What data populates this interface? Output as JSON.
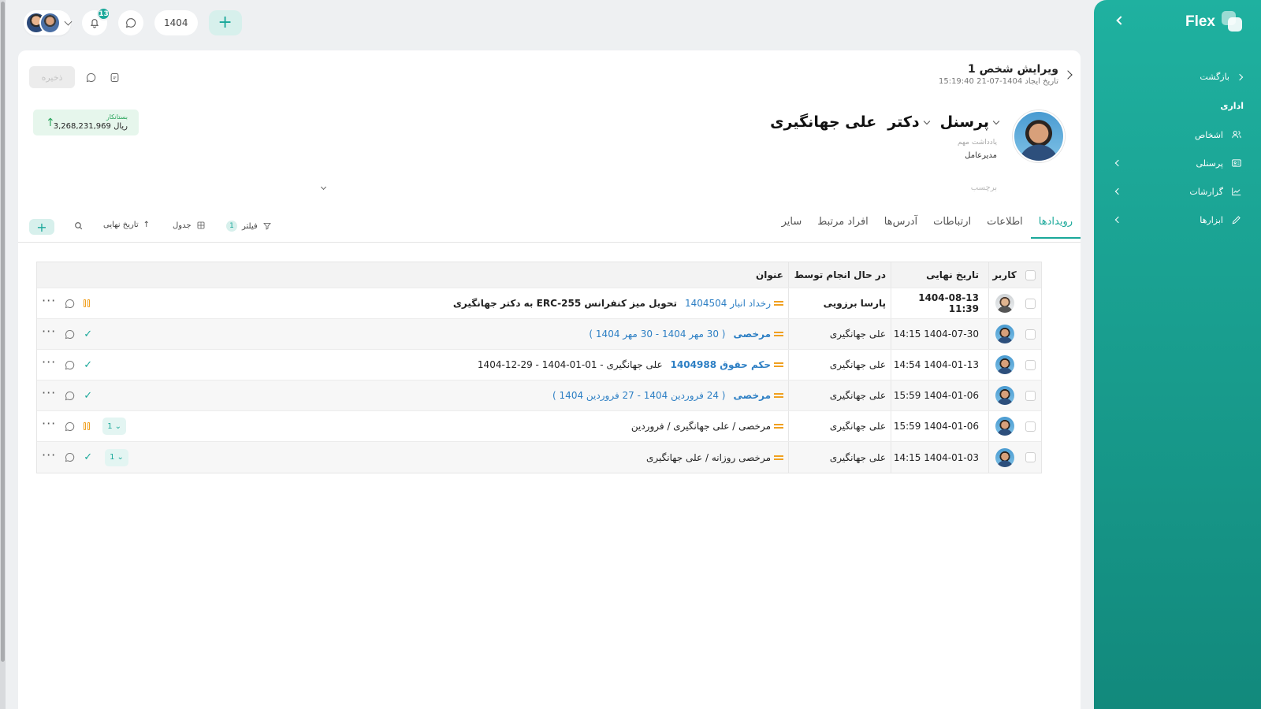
{
  "topbar": {
    "notif_count": "13",
    "year": "1404",
    "add_label": "+"
  },
  "header": {
    "title": "ویرایش شخص 1",
    "created": "تاریخ ایجاد 1404-07-21 15:19:40",
    "save_label": "ذخیره"
  },
  "profile": {
    "name": "علی جهانگیری",
    "title": "دکتر",
    "group": "پرسنل",
    "note_label": "یادداشت مهم",
    "role": "مدیرعامل",
    "tag_label": "برچسب"
  },
  "balance": {
    "label": "بستانکار",
    "value": "3,268,231,969 ریال"
  },
  "tabs": [
    {
      "label": "رویدادها",
      "active": true
    },
    {
      "label": "اطلاعات"
    },
    {
      "label": "ارتباطات"
    },
    {
      "label": "آدرس‌ها"
    },
    {
      "label": "افراد مرتبط"
    },
    {
      "label": "سایر"
    }
  ],
  "tools": {
    "filter_label": "فیلتر",
    "filter_count": "1",
    "view_label": "جدول",
    "sort_label": "تاریخ نهایی"
  },
  "table": {
    "headers": {
      "user": "کاربر",
      "date": "تاریخ نهایی",
      "by": "در حال انجام توسط",
      "title": "عنوان"
    },
    "rows": [
      {
        "date": "1404-08-13 11:39",
        "by": "پارسا برزویی",
        "prefix": "",
        "link": "رخداد انبار 1404504",
        "text": "تحویل میز کنفرانس ERC-255 به دکتر جهانگیری",
        "status": "pause",
        "count": ""
      },
      {
        "date": "1404-07-30 14:15",
        "by": "علی جهانگیری",
        "prefix": "مرخصی",
        "link": "( 30 مهر 1404 - 30 مهر 1404 )",
        "text": "",
        "status": "done",
        "count": ""
      },
      {
        "date": "1404-01-13 14:54",
        "by": "علی جهانگیری",
        "prefix": "حکم حقوق 1404988",
        "link": "",
        "text": "علی جهانگیری - 01-01-1404 - 29-12-1404",
        "status": "done",
        "count": ""
      },
      {
        "date": "1404-01-06 15:59",
        "by": "علی جهانگیری",
        "prefix": "مرخصی",
        "link": "( 24 فروردین 1404 - 27 فروردین 1404 )",
        "text": "",
        "status": "done",
        "count": ""
      },
      {
        "date": "1404-01-06 15:59",
        "by": "علی جهانگیری",
        "prefix": "",
        "link": "",
        "text": "مرخصی / علی جهانگیری / فروردین",
        "status": "pause",
        "count": "1"
      },
      {
        "date": "1404-01-03 14:15",
        "by": "علی جهانگیری",
        "prefix": "",
        "link": "",
        "text": "مرخصی روزانه / علی جهانگیری",
        "status": "done",
        "count": "1"
      }
    ]
  },
  "sidebar": {
    "brand": "Flex",
    "back": "بازگشت",
    "section": "اداری",
    "items": [
      {
        "label": "اشخاص",
        "icon": "users-icon"
      },
      {
        "label": "پرسنلی",
        "icon": "id-card-icon"
      },
      {
        "label": "گزارشات",
        "icon": "chart-icon"
      },
      {
        "label": "ابزارها",
        "icon": "pencil-icon"
      }
    ]
  }
}
